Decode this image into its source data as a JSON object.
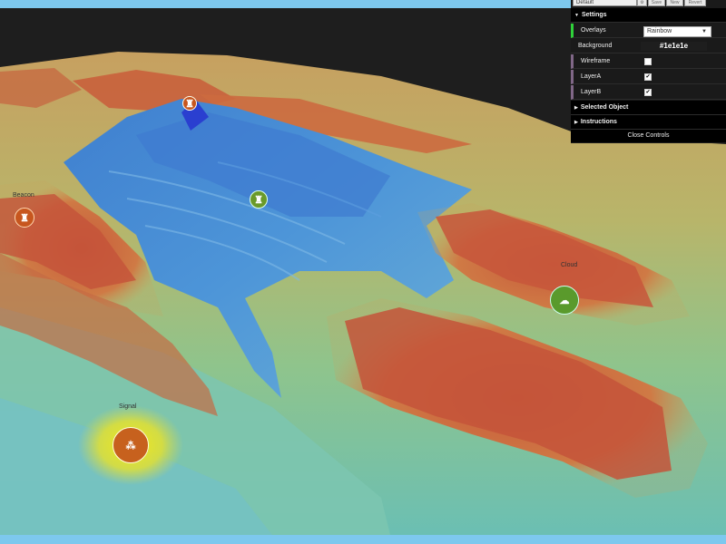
{
  "gui": {
    "preset": "Default",
    "buttons": [
      "Save",
      "New",
      "Revert"
    ],
    "settings_label": "Settings",
    "overlays_label": "Overlays",
    "overlays_value": "Rainbow",
    "background_label": "Background",
    "background_value": "#1e1e1e",
    "wireframe_label": "Wireframe",
    "wireframe_checked": false,
    "layerA_label": "LayerA",
    "layerA_checked": true,
    "layerB_label": "LayerB",
    "layerB_checked": true,
    "selected_object_label": "Selected Object",
    "instructions_label": "Instructions",
    "close_label": "Close Controls"
  },
  "markers": {
    "signal_label": "Signal",
    "cloud_label": "Cloud",
    "beacon_label": "Beacon"
  },
  "colors": {
    "frame": "#7dc8ee",
    "background": "#1e1e1e",
    "panel": "#1a1a1a",
    "accent": "#2fa1d6"
  }
}
